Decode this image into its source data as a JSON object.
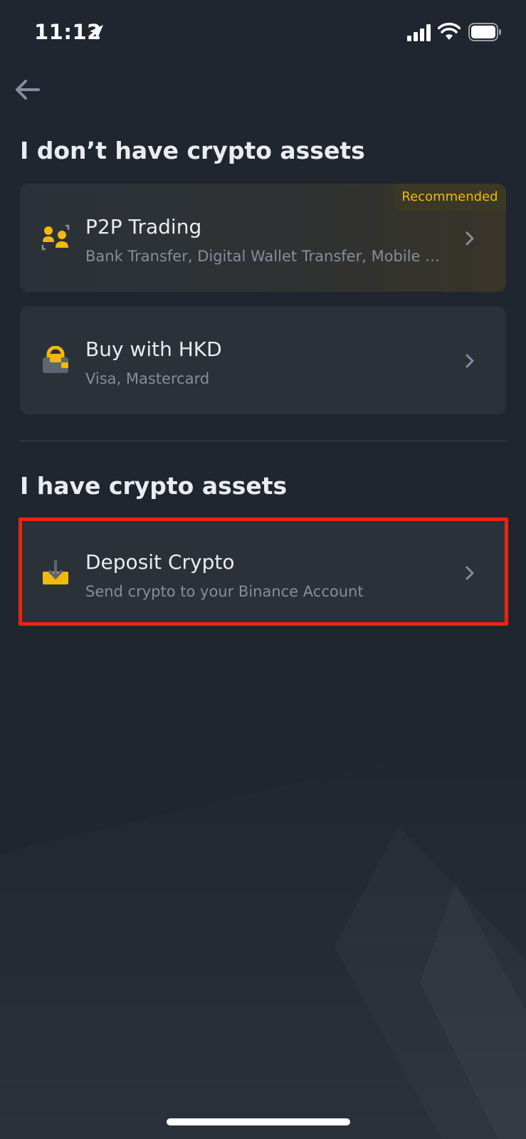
{
  "status_bar": {
    "time": "11:12"
  },
  "header": {
    "back_icon": "arrow-left-icon"
  },
  "sections": {
    "no_assets": {
      "title": "I don’t have crypto assets"
    },
    "has_assets": {
      "title": "I have crypto assets"
    }
  },
  "options": {
    "p2p": {
      "title": "P2P Trading",
      "subtitle": "Bank Transfer, Digital Wallet Transfer, Mobile Payment",
      "badge": "Recommended",
      "icon": "p2p-users-icon"
    },
    "buy": {
      "title": "Buy with HKD",
      "subtitle": "Visa, Mastercard",
      "icon": "wallet-lock-icon"
    },
    "deposit": {
      "title": "Deposit Crypto",
      "subtitle": "Send crypto to your Binance Account",
      "icon": "deposit-tray-icon"
    }
  },
  "colors": {
    "background": "#202630",
    "card": "#2B3139",
    "accent": "#F0B90B",
    "highlight": "#E8250F",
    "secondary_text": "#848E9C"
  }
}
